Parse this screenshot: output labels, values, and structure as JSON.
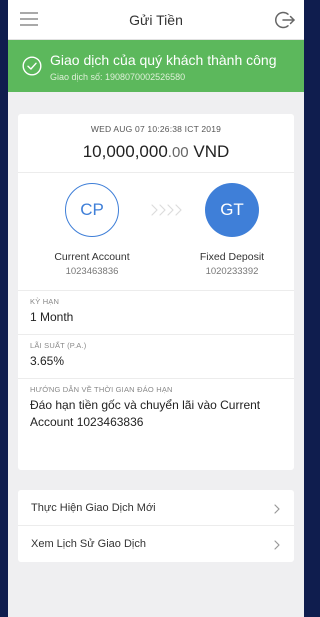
{
  "header": {
    "title": "Gửi Tiền",
    "menu_icon": "hamburger-menu-icon",
    "logout_icon": "logout-arrow-icon"
  },
  "banner": {
    "title": "Giao dịch của quý khách thành công",
    "subtitle": "Giao dịch số: 1908070002526580",
    "icon": "check-circle-icon",
    "color": "#5cb85c"
  },
  "summary": {
    "timestamp": "WED AUG 07 10:26:38 ICT 2019",
    "amount_whole": "10,000,000",
    "amount_decimal": ".00",
    "currency": "VND",
    "from": {
      "initials": "CP",
      "name": "Current Account",
      "number": "1023463836"
    },
    "to": {
      "initials": "GT",
      "name": "Fixed Deposit",
      "number": "1020233392"
    },
    "accent_color": "#3f7fd8"
  },
  "details": {
    "term_label": "KỲ HẠN",
    "term_value": "1 Month",
    "rate_label": "LÃI SUẤT (P.A.)",
    "rate_value": "3.65%",
    "maturity_label": "HƯỚNG DẪN VỀ THỜI GIAN ĐÁO HẠN",
    "maturity_value": "Đáo hạn tiền gốc và chuyển lãi vào Current Account 1023463836"
  },
  "actions": [
    {
      "label": "Thực Hiện Giao Dịch Mới"
    },
    {
      "label": "Xem Lịch Sử Giao Dịch"
    }
  ]
}
